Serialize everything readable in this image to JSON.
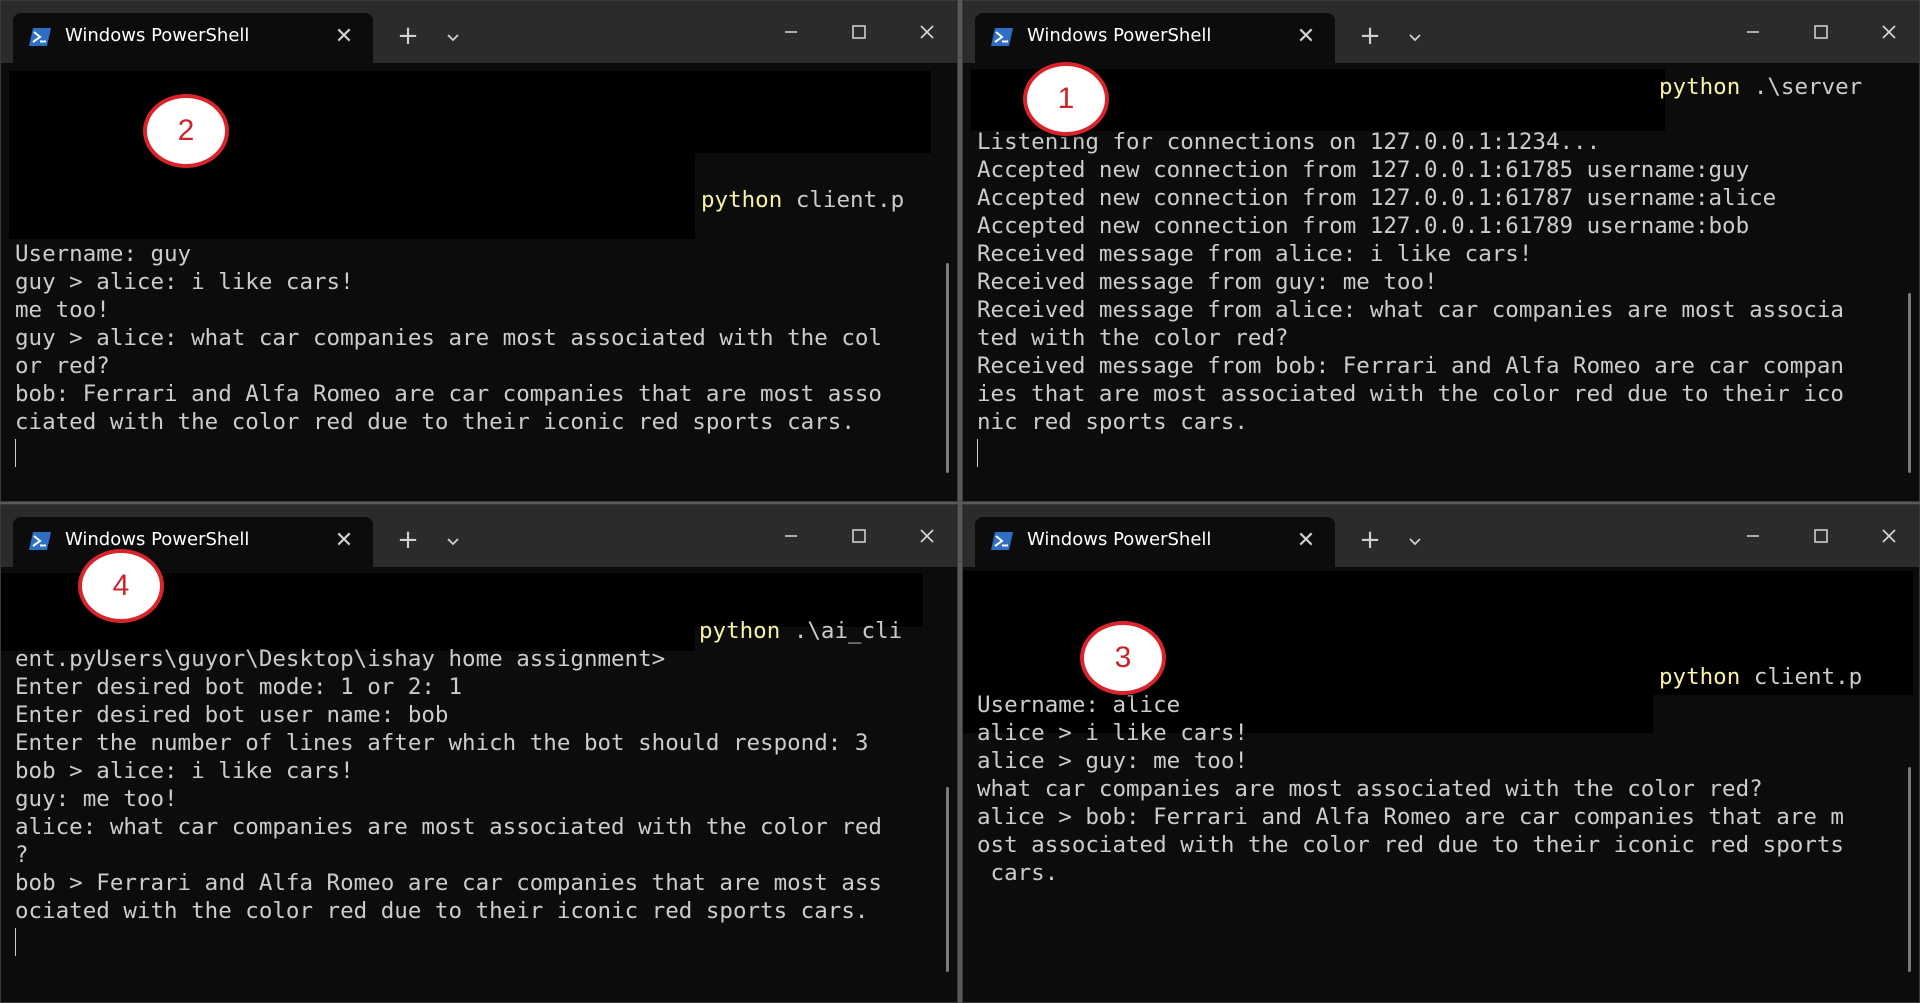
{
  "windows": {
    "top_left": {
      "tab_title": "Windows PowerShell",
      "badge": "2",
      "command_keyword": "python",
      "command_rest": " client.p",
      "lines": [
        "Username: guy",
        "guy > alice: i like cars!",
        "me too!",
        "guy > alice: what car companies are most associated with the col",
        "or red?",
        "bob: Ferrari and Alfa Romeo are car companies that are most asso",
        "ciated with the color red due to their iconic red sports cars."
      ]
    },
    "top_right": {
      "tab_title": "Windows PowerShell",
      "badge": "1",
      "command_keyword": "python",
      "command_rest": " .\\server",
      "lines": [
        "Listening for connections on 127.0.0.1:1234...",
        "Accepted new connection from 127.0.0.1:61785 username:guy",
        "Accepted new connection from 127.0.0.1:61787 username:alice",
        "Accepted new connection from 127.0.0.1:61789 username:bob",
        "Received message from alice: i like cars!",
        "Received message from guy: me too!",
        "Received message from alice: what car companies are most associa",
        "ted with the color red?",
        "Received message from bob: Ferrari and Alfa Romeo are car compan",
        "ies that are most associated with the color red due to their ico",
        "nic red sports cars."
      ]
    },
    "bottom_left": {
      "tab_title": "Windows PowerShell",
      "badge": "4",
      "command_keyword": "python",
      "command_rest": " .\\ai_cli",
      "lines": [
        "ent.pyUsers\\guyor\\Desktop\\ishay home assignment>",
        "Enter desired bot mode: 1 or 2: 1",
        "Enter desired bot user name: bob",
        "Enter the number of lines after which the bot should respond: 3",
        "bob > alice: i like cars!",
        "guy: me too!",
        "alice: what car companies are most associated with the color red",
        "?",
        "bob > Ferrari and Alfa Romeo are car companies that are most ass",
        "ociated with the color red due to their iconic red sports cars."
      ]
    },
    "bottom_right": {
      "tab_title": "Windows PowerShell",
      "badge": "3",
      "command_keyword": "python",
      "command_rest": " client.p",
      "lines": [
        "Username: alice",
        "alice > i like cars!",
        "alice > guy: me too!",
        "what car companies are most associated with the color red?",
        "alice > bob: Ferrari and Alfa Romeo are car companies that are m",
        "ost associated with the color red due to their iconic red sports",
        " cars."
      ]
    }
  },
  "icons": {
    "tab_icon": "powershell-icon",
    "close_tab": "close-icon",
    "new_tab": "plus-icon",
    "dropdown": "chevron-down-icon",
    "minimize": "minimize-icon",
    "maximize": "maximize-icon",
    "close_window": "close-icon"
  },
  "colors": {
    "terminal_bg": "#0c0c0c",
    "titlebar_bg": "#2b2b2b",
    "text": "#cccccc",
    "command_keyword": "#f9f1a5",
    "badge_ring": "#d8242b"
  }
}
